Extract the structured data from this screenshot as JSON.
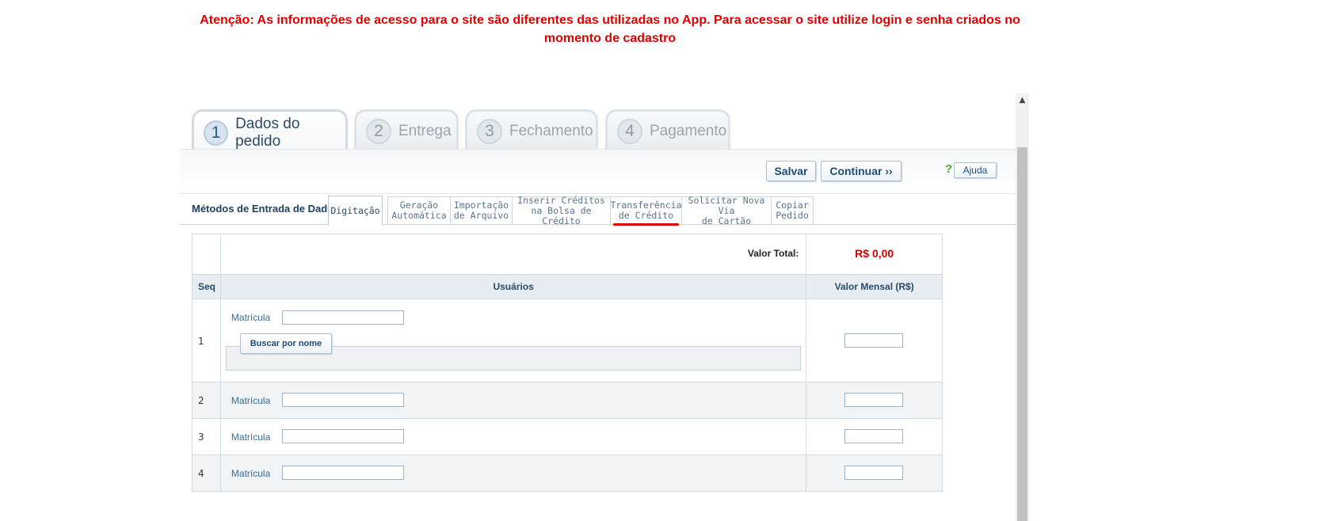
{
  "warning": {
    "line1": "Atenção: As informações de acesso para o site são diferentes das utilizadas no App. Para acessar o site utilize login e senha criados no",
    "line2": "momento de cadastro"
  },
  "steps": [
    {
      "num": "1",
      "label": "Dados do pedido"
    },
    {
      "num": "2",
      "label": "Entrega"
    },
    {
      "num": "3",
      "label": "Fechamento"
    },
    {
      "num": "4",
      "label": "Pagamento"
    }
  ],
  "toolbar": {
    "save_label": "Salvar",
    "continue_label": "Continuar ››",
    "help_symbol": "?",
    "help_label": "Ajuda"
  },
  "methods": {
    "label": "Métodos de Entrada de Dados",
    "tabs": [
      {
        "line1": "Digitação",
        "line2": ""
      },
      {
        "line1": "Geração",
        "line2": "Automática"
      },
      {
        "line1": "Importação",
        "line2": "de Arquivo"
      },
      {
        "line1": "Inserir Créditos",
        "line2": "na Bolsa de Crédito"
      },
      {
        "line1": "Transferência",
        "line2": "de Crédito"
      },
      {
        "line1": "Solicitar Nova Via",
        "line2": "de Cartão"
      },
      {
        "line1": "Copiar",
        "line2": "Pedido"
      }
    ]
  },
  "table": {
    "total_label": "Valor Total:",
    "total_value": "R$ 0,00",
    "headers": {
      "seq": "Seq",
      "users": "Usuários",
      "value": "Valor Mensal (R$)"
    },
    "matricula_label": "Matrícula",
    "search_button": "Buscar por nome",
    "rows": [
      {
        "seq": "1",
        "matricula": "",
        "valor": ""
      },
      {
        "seq": "2",
        "matricula": "",
        "valor": ""
      },
      {
        "seq": "3",
        "matricula": "",
        "valor": ""
      },
      {
        "seq": "4",
        "matricula": "",
        "valor": ""
      }
    ]
  }
}
